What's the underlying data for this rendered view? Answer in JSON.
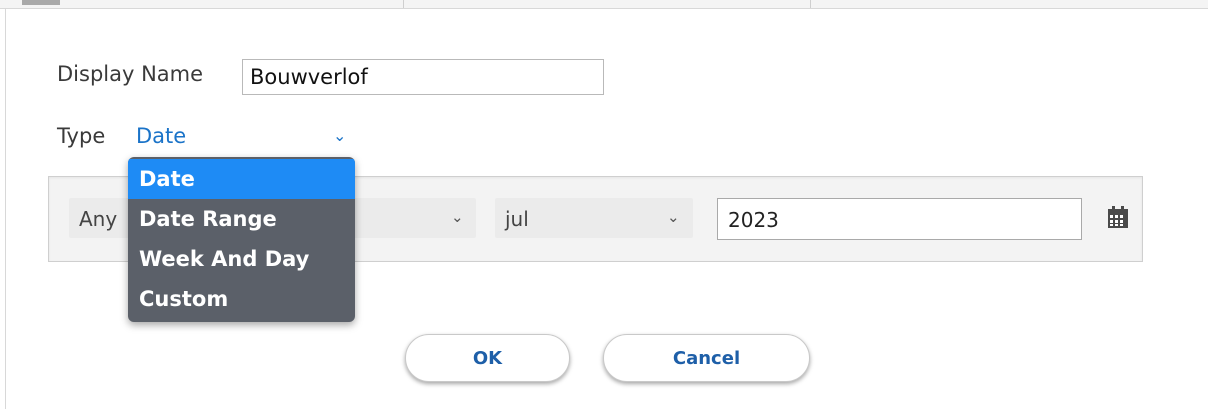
{
  "dialog": {
    "display_name_label": "Display Name",
    "display_name_value": "Bouwverlof",
    "type_label": "Type",
    "type_selected": "Date",
    "type_options": [
      "Date",
      "Date Range",
      "Week And Day",
      "Custom"
    ],
    "day_select_value": "Any",
    "month_select_value": "jul",
    "year_value": "2023",
    "ok_label": "OK",
    "cancel_label": "Cancel"
  },
  "icons": {
    "chevron": "chevron-down-icon",
    "calendar": "calendar-icon"
  },
  "colors": {
    "accent": "#1a73c8",
    "dropdown_bg": "#5b6069",
    "dropdown_selected": "#1e8bf5",
    "button_text": "#1e5fa8"
  }
}
